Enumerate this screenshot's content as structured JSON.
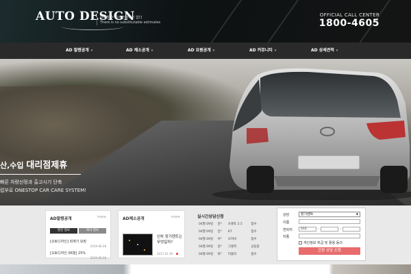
{
  "header": {
    "logo_text": "AUTO DESIGN",
    "tagline_line1": "대체할 수 있는 전략시기 없다",
    "tagline_line2": "There is no substitutable estimates",
    "call_label": "OFFICIAL CALL CENTER",
    "call_number": "1800-4605"
  },
  "nav": {
    "items": [
      {
        "label": "AD 발령공개"
      },
      {
        "label": "AD 제소공개"
      },
      {
        "label": "AD 요원공개"
      },
      {
        "label": "AD 커뮤니티"
      },
      {
        "label": "AD 상세견적"
      }
    ]
  },
  "hero": {
    "title_prefix": "산,수입",
    "title_main": "대리점제휴",
    "sub_line1": "빠른 차량선정과 출고시기 단축",
    "sub_line2": "럽부로 ONESTOP CAR CARE SYSTEM!"
  },
  "notice_card": {
    "title": "AD발령공개",
    "more": "more",
    "tabs": [
      "발신 정보",
      "회사 정보"
    ],
    "items": [
      {
        "text": "[오토디자인] 회계기 보장",
        "date": "2019-06-28"
      },
      {
        "text": "[오토디자인 06월] 25%",
        "date": "2019-06-28"
      }
    ]
  },
  "review_card": {
    "title": "AD제소공개",
    "more": "more",
    "post_title": "신차 장기렌트는 무엇일까?",
    "post_date": "2017.01.19"
  },
  "live": {
    "title": "실시간상담신청",
    "rows": [
      {
        "date": "04월 09일",
        "name": "김*",
        "car": "쏘렌토 2.5",
        "status": "접수"
      },
      {
        "date": "04월 09일",
        "name": "임*",
        "car": "K7",
        "status": "접수"
      },
      {
        "date": "04월 09일",
        "name": "이*",
        "car": "모하비",
        "status": "접수"
      },
      {
        "date": "04월 09일",
        "name": "김*",
        "car": "그랜저",
        "status": "상담중"
      },
      {
        "date": "04월 09일",
        "name": "박*",
        "car": "티볼리",
        "status": "접수"
      }
    ]
  },
  "form": {
    "type_label": "상담",
    "type_value": "장기렌트",
    "name_label": "이름",
    "phone_label": "연락처",
    "phone_prefix": "010",
    "car_label": "차종",
    "agree_label": "개인정보 취급 및 활용 동의",
    "submit_label": "간편 상담 신청"
  },
  "colors": {
    "nav_bg": "#2a2a2a",
    "submit_bg": "#e86c6c",
    "tab_dark": "#333333",
    "tab_gray": "#8a8a8a"
  }
}
